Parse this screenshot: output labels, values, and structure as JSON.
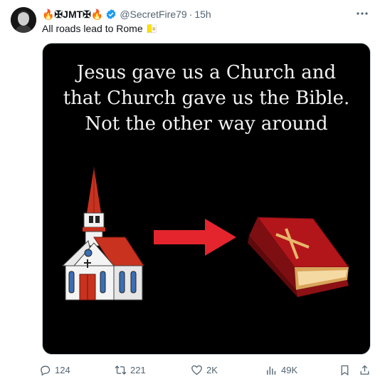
{
  "tweet": {
    "display_name": "🔥✠JMT✠🔥",
    "handle": "@SecretFire79",
    "separator": "·",
    "time": "15h",
    "text": "All roads lead to Rome 🇻🇦",
    "more_icon": "ellipsis-icon",
    "verified_color": "#1d9bf0"
  },
  "media": {
    "lines": [
      "Jesus gave us a Church and",
      "that Church gave us the Bible.",
      "Not the other way around"
    ],
    "church_icon": "church-icon",
    "arrow_icon": "arrow-right-icon",
    "bible_icon": "bible-icon"
  },
  "actions": {
    "replies": "124",
    "reposts": "221",
    "likes": "2K",
    "views": "49K"
  }
}
